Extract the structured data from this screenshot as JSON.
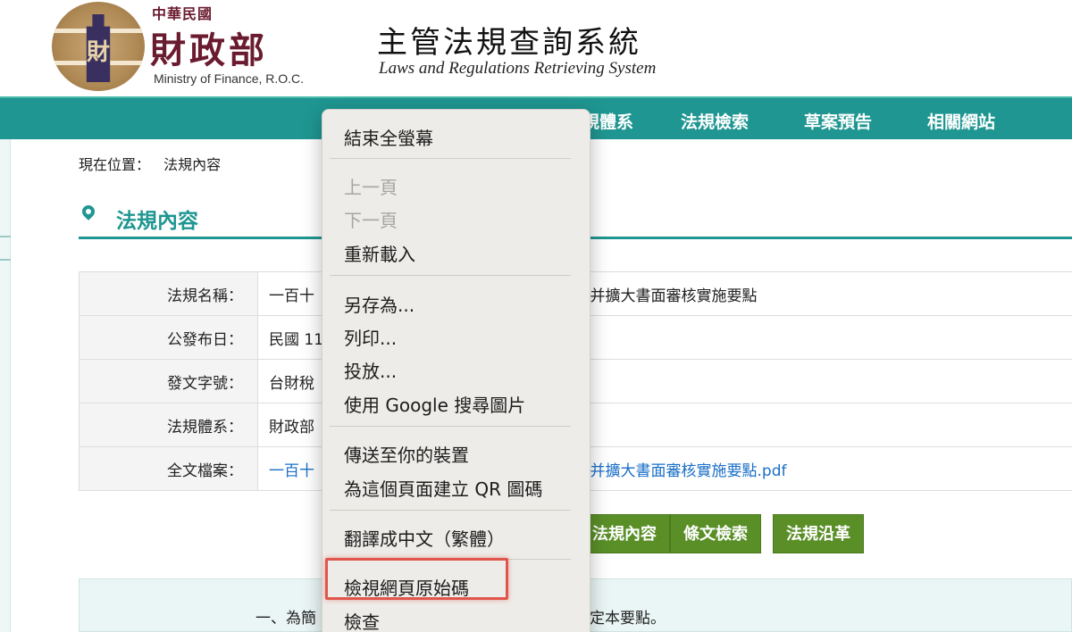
{
  "header": {
    "roc_label": "中華民國",
    "ministry_zh": "財政部",
    "ministry_en": "Ministry of Finance, R.O.C.",
    "seal_glyph": "財",
    "site_title_zh": "主管法規查詢系統",
    "site_title_en": "Laws and Regulations Retrieving System"
  },
  "nav": {
    "items": [
      "規體系",
      "法規檢索",
      "草案預告",
      "相關網站"
    ]
  },
  "breadcrumb": {
    "label": "現在位置：",
    "current": "法規內容"
  },
  "section": {
    "title": "法規內容"
  },
  "info_table": {
    "rows": [
      {
        "label": "法規名稱：",
        "value_left": "一百十",
        "value_right": "并擴大書面審核實施要點"
      },
      {
        "label": "公發布日：",
        "value_left": "民國 11",
        "value_right": ""
      },
      {
        "label": "發文字號：",
        "value_left": "台財稅",
        "value_right": ""
      },
      {
        "label": "法規體系：",
        "value_left": "財政部",
        "value_right": ""
      },
      {
        "label": "全文檔案：",
        "value_left": "一百十",
        "value_right": "并擴大書面審核實施要點.pdf"
      }
    ]
  },
  "buttons": {
    "content": "法規內容",
    "search": "條文檢索",
    "history": "法規沿革"
  },
  "content": {
    "text_left": "一、為簡",
    "text_right": "定本要點。"
  },
  "context_menu": {
    "exit_fullscreen": "結束全螢幕",
    "back": "上一頁",
    "forward": "下一頁",
    "reload": "重新載入",
    "save_as": "另存為...",
    "print": "列印...",
    "cast": "投放...",
    "google_image_search": "使用 Google 搜尋圖片",
    "send_to_devices": "傳送至你的裝置",
    "create_qr": "為這個頁面建立 QR 圖碼",
    "translate": "翻譯成中文（繁體）",
    "view_source": "檢視網頁原始碼",
    "inspect": "檢查"
  },
  "colors": {
    "nav_bg": "#1f9691",
    "accent_teal": "#1f9691",
    "button_green": "#5a8f28",
    "link_blue": "#1a6fc7",
    "highlight_red": "#e0564c",
    "ministry_maroon": "#6a1b2f"
  }
}
